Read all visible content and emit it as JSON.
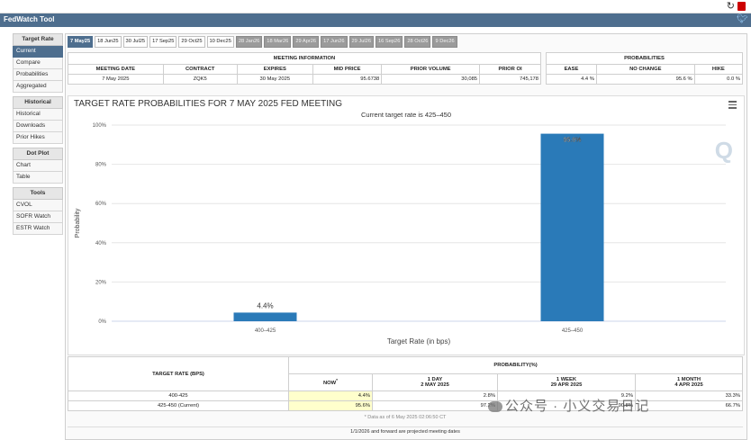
{
  "app": {
    "title": "FedWatch Tool"
  },
  "icons": {
    "refresh": "refresh-icon",
    "pdf": "pdf-icon",
    "twitter": "twitter-icon",
    "menu": "hamburger-menu-icon",
    "watermark": "quikstrike-q-logo"
  },
  "colors": {
    "accent": "#4e6e8e",
    "bar": "#2a7ab8",
    "highlight": "#ffffcc"
  },
  "sidebar": {
    "sections": [
      {
        "title": "Target Rate",
        "items": [
          "Current",
          "Compare",
          "Probabilities",
          "Aggregated"
        ]
      },
      {
        "title": "Historical",
        "items": [
          "Historical",
          "Downloads",
          "Prior Hikes"
        ]
      },
      {
        "title": "Dot Plot",
        "items": [
          "Chart",
          "Table"
        ]
      },
      {
        "title": "Tools",
        "items": [
          "CVOL",
          "SOFR Watch",
          "ESTR Watch"
        ]
      }
    ],
    "active": "Current"
  },
  "tabs": {
    "items": [
      "7 May25",
      "18 Jun25",
      "30 Jul25",
      "17 Sep25",
      "29 Oct25",
      "10 Dec25",
      "28 Jan26",
      "18 Mar26",
      "29 Apr26",
      "17 Jun26",
      "29 Jul26",
      "16 Sep26",
      "28 Oct26",
      "9 Dec26"
    ],
    "active_index": 0,
    "projected_from_index": 6
  },
  "meeting_info": {
    "title": "MEETING INFORMATION",
    "headers": [
      "MEETING DATE",
      "CONTRACT",
      "EXPIRES",
      "MID PRICE",
      "PRIOR VOLUME",
      "PRIOR OI"
    ],
    "row": [
      "7 May 2025",
      "ZQK5",
      "30 May 2025",
      "95.6738",
      "30,085",
      "745,178"
    ]
  },
  "probabilities": {
    "title": "PROBABILITIES",
    "headers": [
      "EASE",
      "NO CHANGE",
      "HIKE"
    ],
    "row": [
      "4.4 %",
      "95.6 %",
      "0.0 %"
    ]
  },
  "chart": {
    "title": "TARGET RATE PROBABILITIES FOR 7 MAY 2025 FED MEETING",
    "subtitle": "Current target rate is 425–450"
  },
  "chart_data": {
    "type": "bar",
    "title": "TARGET RATE PROBABILITIES FOR 7 MAY 2025 FED MEETING",
    "subtitle": "Current target rate is 425–450",
    "categories": [
      "400–425",
      "425–450"
    ],
    "values": [
      4.4,
      95.6
    ],
    "data_labels": [
      "4.4%",
      "95.6%"
    ],
    "xlabel": "Target Rate (in bps)",
    "ylabel": "Probability",
    "ylim": [
      0,
      100
    ],
    "yticks": [
      "0%",
      "20%",
      "40%",
      "60%",
      "80%",
      "100%"
    ],
    "ytick_values": [
      0,
      20,
      40,
      60,
      80,
      100
    ],
    "grid": true,
    "bar_color": "#2a7ab8"
  },
  "bottom_table": {
    "title": "PROBABILITY(%)",
    "col_rate": "TARGET RATE (BPS)",
    "col_now": "NOW",
    "col_now_mark": "*",
    "col_1day": {
      "label": "1 DAY",
      "date": "2 MAY 2025"
    },
    "col_1week": {
      "label": "1 WEEK",
      "date": "29 APR 2025"
    },
    "col_1month": {
      "label": "1 MONTH",
      "date": "4 APR 2025"
    },
    "rows": [
      {
        "rate": "400-425",
        "now": "4.4%",
        "day": "2.8%",
        "week": "9.2%",
        "month": "33.3%"
      },
      {
        "rate": "425-450 (Current)",
        "now": "95.6%",
        "day": "97.2%",
        "week": "90.8%",
        "month": "66.7%"
      }
    ]
  },
  "footer": {
    "note": "* Data as of 6 May 2025 02:06:50 CT",
    "projected": "1/1/2026 and forward are projected meeting dates"
  },
  "watermark_text": "公众号 · 小义交易日记"
}
